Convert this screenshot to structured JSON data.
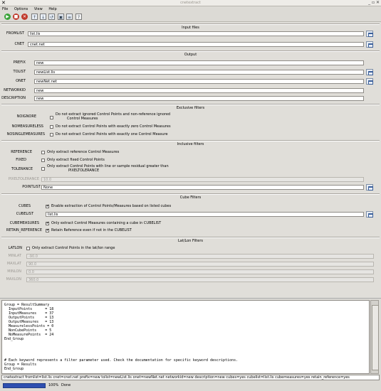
{
  "window": {
    "title": "cnetextract"
  },
  "menu": [
    "File",
    "Options",
    "View",
    "Help"
  ],
  "sections": {
    "input": "Input files",
    "output": "Output",
    "exclusive": "Exclusive filters",
    "inclusive": "Inclusive filters",
    "cube": "Cube Filters",
    "latlon": "Lat/Lon Filters"
  },
  "fields": {
    "fromlist": {
      "label": "FROMLIST",
      "value": "list.lis"
    },
    "cnet": {
      "label": "CNET",
      "value": "cnet.net"
    },
    "prefix": {
      "label": "PREFIX",
      "value": "new"
    },
    "tolist": {
      "label": "TOLIST",
      "value": "newList.lis"
    },
    "onet": {
      "label": "ONET",
      "value": "newNet.net"
    },
    "networkid": {
      "label": "NETWORKID",
      "value": "new"
    },
    "description": {
      "label": "DESCRIPTION",
      "value": "new"
    },
    "pixeltolerance": {
      "label": "PIXELTOLERANCE",
      "value": "10.0"
    },
    "pointlist": {
      "label": "POINTLIST",
      "value": "None"
    },
    "cubelist": {
      "label": "CUBELIST",
      "value": "list.lis"
    },
    "minlat": {
      "label": "MINLAT",
      "value": "-90.0"
    },
    "maxlat": {
      "label": "MAXLAT",
      "value": "90.0"
    },
    "minlon": {
      "label": "MINLON",
      "value": "0.0"
    },
    "maxlon": {
      "label": "MAXLON",
      "value": "360.0"
    }
  },
  "checks": {
    "noignore": {
      "label": "NOIGNORE",
      "text1": "Do not extract ignored Control Points and non-reference ignored",
      "text2": "Control Measures"
    },
    "nomeasureless": {
      "label": "NOMEASURELESS",
      "text": "Do not extract Control Points with exactly zero Control Measures"
    },
    "nosinglemeasures": {
      "label": "NOSINGLEMEASURES",
      "text": "Do not extract Control Points with exactly one Control Measure"
    },
    "reference": {
      "label": "REFERENCE",
      "text": "Only extract reference Control Measures"
    },
    "fixed": {
      "label": "FIXED",
      "text": "Only extract fixed Control Points"
    },
    "tolerance": {
      "label": "TOLERANCE",
      "text1": "Only extract Control Points with line or sample residual greater than",
      "text2": "PIXELTOLERANCE"
    },
    "cubes": {
      "label": "CUBES",
      "text": "Enable extraction of Control Points/Measures based on listed cubes",
      "mark": "✔"
    },
    "cubemeasures": {
      "label": "CUBEMEASURES",
      "text": "Only extract Control Measures containing a cube in CUBELIST",
      "mark": "✔"
    },
    "retain_reference": {
      "label": "RETAIN_REFERENCE",
      "text": "Retain Reference even if not in the CUBELIST",
      "mark": "✔"
    },
    "latlon": {
      "label": "LATLON",
      "text": "Only extract Control Points in the lat/lon range"
    }
  },
  "log": {
    "text": "Group = ResultSummary\n  InputPoints      = 18\n  InputMeasures    = 37\n  OutputPoints     = 13\n  OutputMeasures   = 13\n  MeasurelessPoints = 0\n  NonCubePoints    = 5\n  NoMeasurePoints  = 24\nEnd_Group\n\n\n\n\n# Each keyword represents a filter parameter used. Check the documentation for specific keyword descriptions.\nGroup = Results\nEnd_Group"
  },
  "command": "cnetextract fromlist=list.lis cnet=cnet.net prefix=new tolist=newList.lis onet=newNet.net networkid=new description=new cubes=yes cubelist=list.lis cubemeasures=yes retain_reference=yes",
  "status": {
    "percent": "100%",
    "progress": 1.0,
    "text": "Done"
  },
  "colors": {
    "run": "#3aa339",
    "stop": "#c0392b",
    "exit": "#c0392b",
    "progress": "#2f4fb0"
  }
}
